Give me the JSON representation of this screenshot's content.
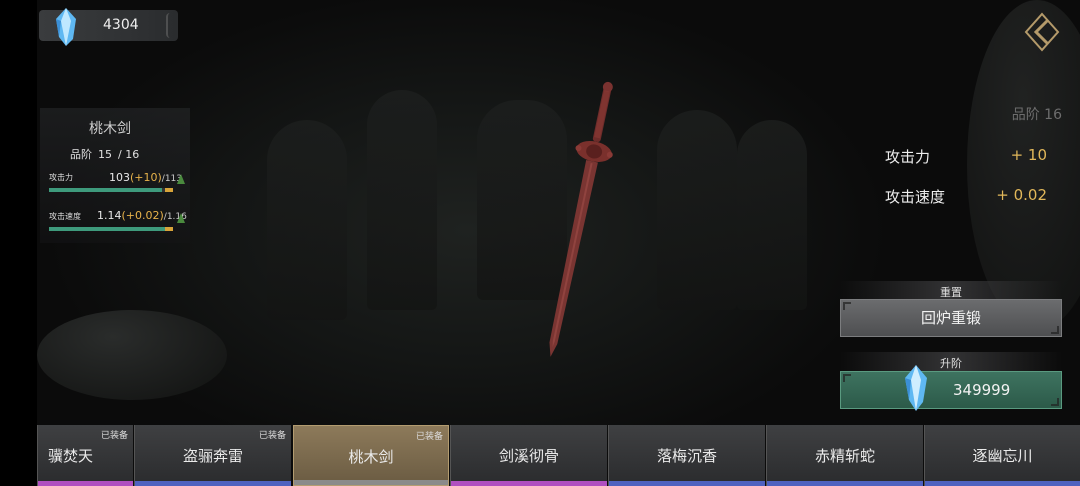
{
  "currency": {
    "amount": "4304",
    "icon": "blue-crystal-icon"
  },
  "menu": {
    "icon": "diamond-chevron-icon"
  },
  "weapon": {
    "name": "桃木剑",
    "grade_label": "品阶",
    "grade_current": "15",
    "grade_max": "/ 16",
    "stats": [
      {
        "label": "攻击力",
        "base": "103",
        "bonus": "(+10)",
        "max": "/113",
        "fill": 0.91
      },
      {
        "label": "攻击速度",
        "base": "1.14",
        "bonus": "(+0.02)",
        "max": "/1.16",
        "fill": 0.98
      }
    ]
  },
  "upgrade": {
    "next_grade": "品阶 16",
    "rows": [
      {
        "label": "攻击力",
        "delta": "+ 10"
      },
      {
        "label": "攻击速度",
        "delta": "+ 0.02"
      }
    ],
    "reset_label": "重置",
    "reforge_button": "回炉重锻",
    "ascend_label": "升阶",
    "ascend_cost": "349999"
  },
  "tabs": [
    {
      "name": "骥焚天",
      "equipped": "已装备",
      "rarity_color": "#b04fc0",
      "active": false
    },
    {
      "name": "盗骊奔雷",
      "equipped": "已装备",
      "rarity_color": "#4f62c0",
      "active": false
    },
    {
      "name": "桃木剑",
      "equipped": "已装备",
      "rarity_color": "#8a8a8a",
      "active": true
    },
    {
      "name": "剑溪彻骨",
      "equipped": "",
      "rarity_color": "#b04fc0",
      "active": false
    },
    {
      "name": "落梅沉香",
      "equipped": "",
      "rarity_color": "#4f62c0",
      "active": false
    },
    {
      "name": "赤精斩蛇",
      "equipped": "",
      "rarity_color": "#4f62c0",
      "active": false
    },
    {
      "name": "逐幽忘川",
      "equipped": "",
      "rarity_color": "#4f62c0",
      "active": false
    }
  ]
}
